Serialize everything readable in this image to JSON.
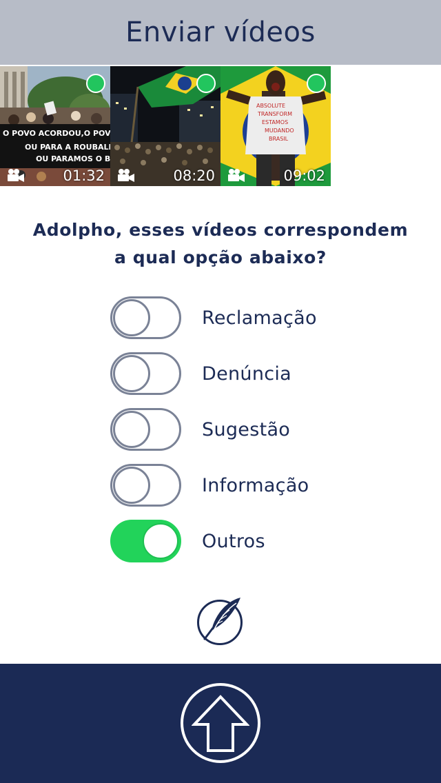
{
  "header": {
    "title": "Enviar vídeos"
  },
  "videos": [
    {
      "duration": "01:32",
      "selected": true,
      "banner_text": [
        "O POVO ACORDOU,O POVO",
        "OU PARA A ROUBALHEI",
        "OU PARAMOS O BR"
      ]
    },
    {
      "duration": "08:20",
      "selected": true
    },
    {
      "duration": "09:02",
      "selected": true,
      "shirt_text": [
        "ABSOLUTE",
        "TRANSFORM",
        "ESTAMOS",
        "MUDANDO",
        "BRASIL"
      ]
    }
  ],
  "question": {
    "line1": "Adolpho, esses vídeos correspondem",
    "line2": "a qual opção abaixo?"
  },
  "options": [
    {
      "label": "Reclamação",
      "on": false
    },
    {
      "label": "Denúncia",
      "on": false
    },
    {
      "label": "Sugestão",
      "on": false
    },
    {
      "label": "Informação",
      "on": false
    },
    {
      "label": "Outros",
      "on": true
    }
  ],
  "icons": {
    "feather": "feather-icon",
    "upload": "upload-arrow-icon",
    "camera": "video-camera-icon",
    "selected": "selected-dot-icon"
  },
  "colors": {
    "header_bg": "#b7bcc7",
    "primary": "#1c2b55",
    "footer_bg": "#1b2a55",
    "toggle_on": "#22d35a",
    "toggle_off_border": "#7a8296",
    "selected_dot": "#22c55e"
  }
}
